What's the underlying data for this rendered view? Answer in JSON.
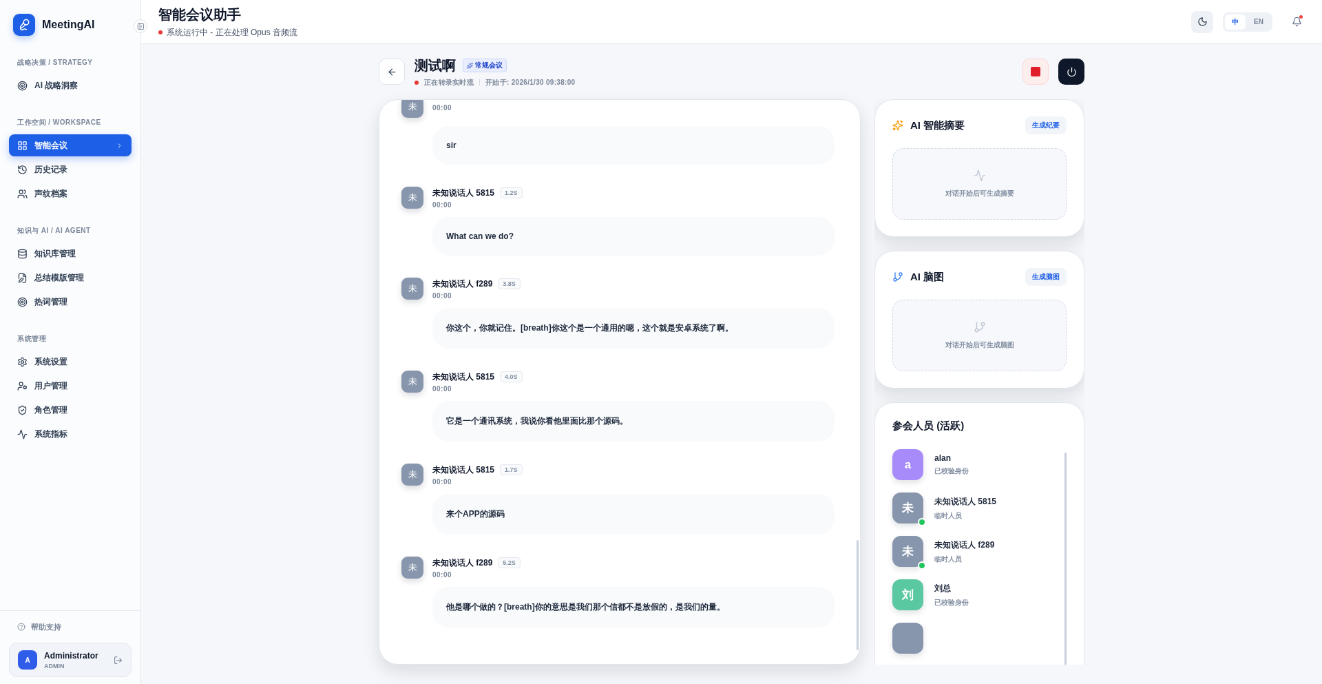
{
  "sidebar": {
    "brand": "MeetingAI",
    "sections": [
      {
        "title": "战略决策 / STRATEGY",
        "items": [
          {
            "label": "AI 战略洞察",
            "selected": false
          }
        ]
      },
      {
        "title": "工作空间 / WORKSPACE",
        "items": [
          {
            "label": "智能会议",
            "selected": true
          },
          {
            "label": "历史记录",
            "selected": false
          },
          {
            "label": "声纹档案",
            "selected": false
          }
        ]
      },
      {
        "title": "知识与 AI / AI AGENT",
        "items": [
          {
            "label": "知识库管理",
            "selected": false
          },
          {
            "label": "总结模版管理",
            "selected": false
          },
          {
            "label": "热词管理",
            "selected": false
          }
        ]
      },
      {
        "title": "系统管理",
        "items": [
          {
            "label": "系统设置",
            "selected": false
          },
          {
            "label": "用户管理",
            "selected": false
          },
          {
            "label": "角色管理",
            "selected": false
          },
          {
            "label": "系统指标",
            "selected": false
          }
        ]
      }
    ],
    "help": "帮助支持",
    "user": {
      "avatar": "A",
      "name": "Administrator",
      "role": "ADMIN"
    }
  },
  "header": {
    "title": "智能会议助手",
    "status": "系统运行中 - 正在处理 Opus 音频流",
    "languages": [
      {
        "label": "中",
        "selected": true
      },
      {
        "label": "EN",
        "selected": false
      }
    ],
    "unread_notifications": true
  },
  "meeting": {
    "title": "测试啊",
    "tag": "常规会议",
    "recording": true,
    "status": "正在转录实时流",
    "started": "开始于: 2026/1/30 09:38:00"
  },
  "transcript": [
    {
      "avatar": "未",
      "time": "00:00",
      "text": "sir"
    },
    {
      "avatar": "未",
      "speaker": "未知说话人 5815",
      "duration": "1.2S",
      "time": "00:00",
      "text": "What can we do?"
    },
    {
      "avatar": "未",
      "speaker": "未知说话人 f289",
      "duration": "3.8S",
      "time": "00:00",
      "text": "你这个，你就记住。[breath]你这个是一个通用的嗯，这个就是安卓系统了啊。"
    },
    {
      "avatar": "未",
      "speaker": "未知说话人 5815",
      "duration": "4.0S",
      "time": "00:00",
      "text": "它是一个通讯系统，我说你看他里面比那个源码。"
    },
    {
      "avatar": "未",
      "speaker": "未知说话人 5815",
      "duration": "1.7S",
      "time": "00:00",
      "text": "来个APP的源码"
    },
    {
      "avatar": "未",
      "speaker": "未知说话人 f289",
      "duration": "5.2S",
      "time": "00:00",
      "text": "他是哪个做的？[breath]你的意思是我们那个信都不是放假的，是我们的量。"
    }
  ],
  "panels": [
    {
      "kind": "summary",
      "title": "AI 智能摘要",
      "button": "生成纪要",
      "empty": "对话开始后可生成摘要"
    },
    {
      "kind": "mindmap",
      "title": "AI 脑图",
      "button": "生成脑图",
      "empty": "对话开始后可生成脑图"
    }
  ],
  "participants": {
    "title": "参会人员 (活跃)",
    "items": [
      {
        "avatar": "a",
        "name": "alan",
        "note": "已校验身份",
        "color": "#a78bfa",
        "online": false
      },
      {
        "avatar": "未",
        "name": "未知说话人 5815",
        "note": "临时人员",
        "color": "#8796ad",
        "online": true
      },
      {
        "avatar": "未",
        "name": "未知说话人 f289",
        "note": "临时人员",
        "color": "#8796ad",
        "online": true
      },
      {
        "avatar": "刘",
        "name": "刘总",
        "note": "已校验身份",
        "color": "#5ac8a0",
        "online": false
      },
      {
        "color": "#8796ad",
        "online": false
      }
    ]
  }
}
